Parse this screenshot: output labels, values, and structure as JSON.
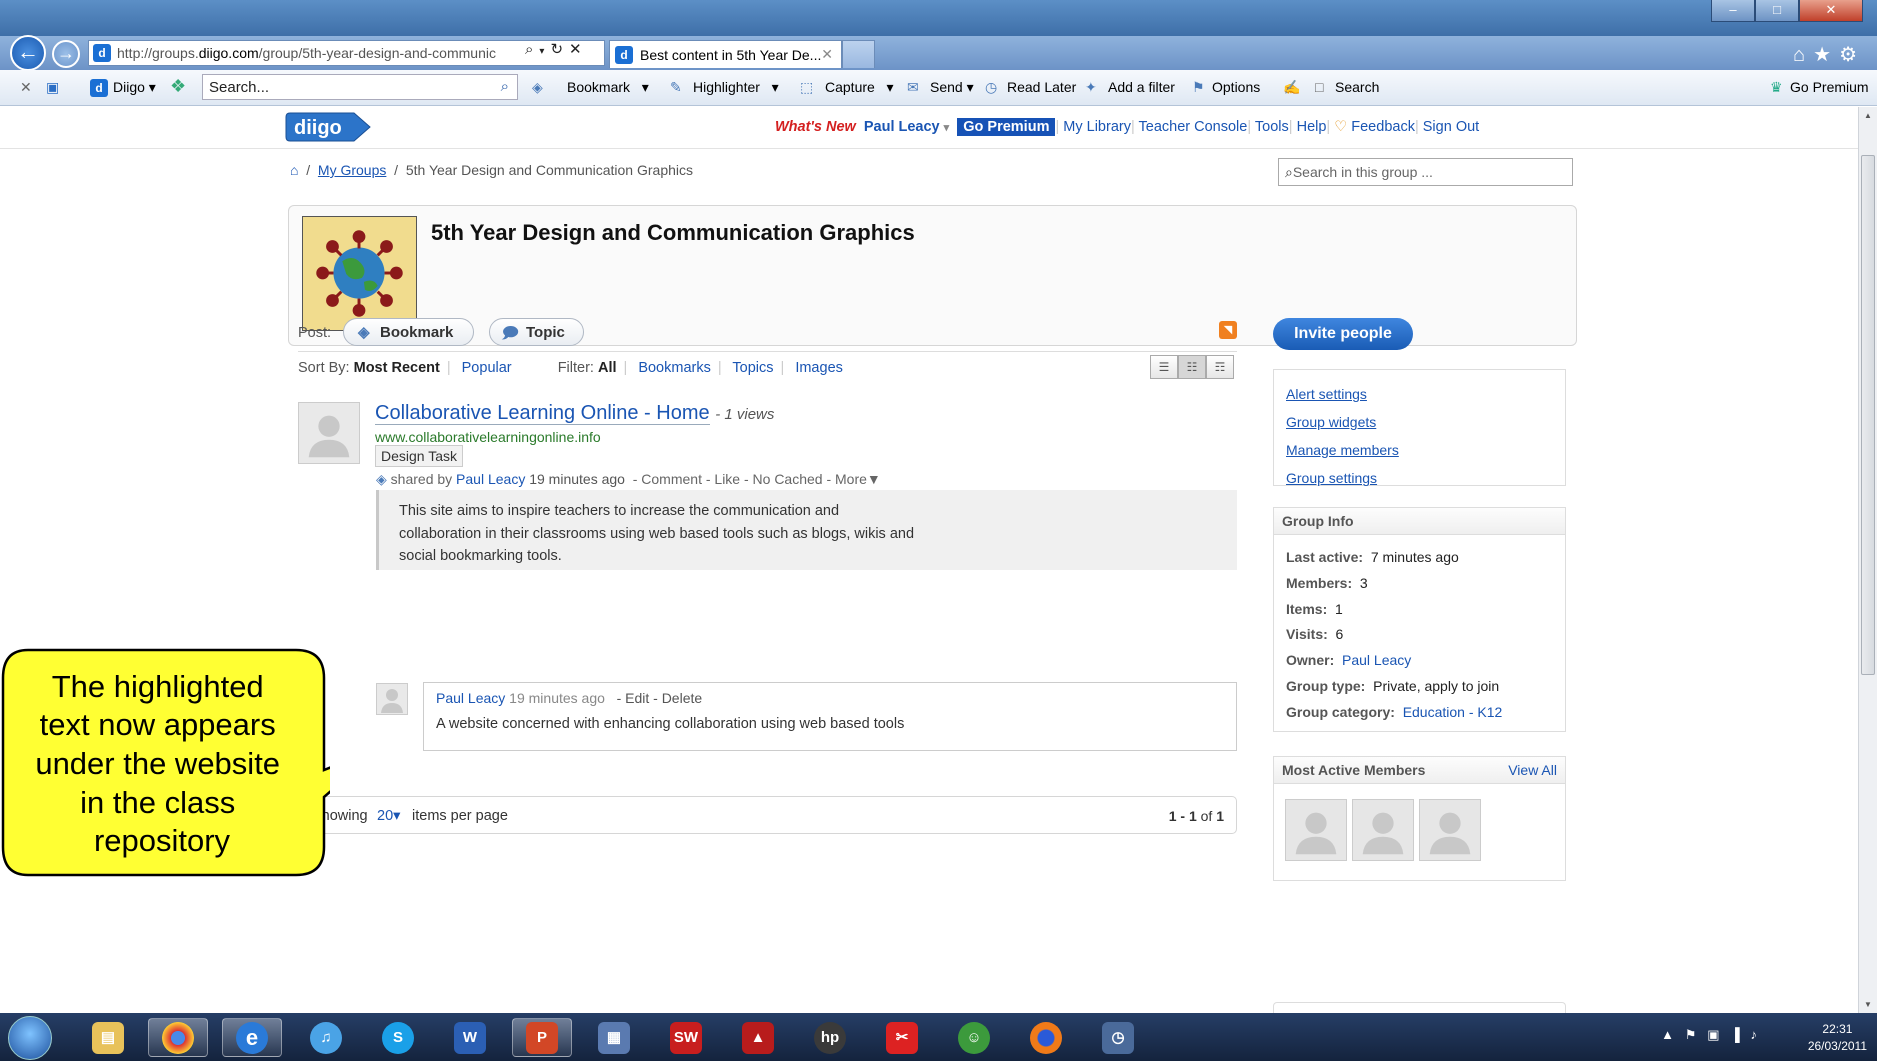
{
  "browser": {
    "address": "http://groups.diigo.com/group/5th-year-design-and-communic",
    "address_host_prefix": "http://groups.",
    "address_host": "diigo.com",
    "address_path": "/group/5th-year-design-and-communic",
    "tab_title": "Best content in 5th Year De...",
    "favicon_letter": "d"
  },
  "toolbar": {
    "diigo_label": "Diigo",
    "search_placeholder": "Search...",
    "items": [
      "Bookmark",
      "Highlighter",
      "Capture",
      "Send",
      "Read Later",
      "Add a filter",
      "Options",
      "Search"
    ],
    "go_premium": "Go Premium"
  },
  "header": {
    "logo": "diigo",
    "whats_new": "What's New",
    "user": "Paul Leacy",
    "go_premium": "Go Premium",
    "links": [
      "My Library",
      "Teacher Console",
      "Tools",
      "Help",
      "Feedback",
      "Sign Out"
    ]
  },
  "breadcrumb": {
    "my_groups": "My Groups",
    "current": "5th Year Design and Communication Graphics"
  },
  "group_search_placeholder": "Search in this group ...",
  "group": {
    "title": "5th Year Design and Communication Graphics"
  },
  "post": {
    "label": "Post:",
    "bookmark": "Bookmark",
    "topic": "Topic"
  },
  "sort": {
    "label": "Sort By:",
    "most_recent": "Most Recent",
    "popular": "Popular",
    "filter_label": "Filter:",
    "all": "All",
    "bookmarks": "Bookmarks",
    "topics": "Topics",
    "images": "Images"
  },
  "item": {
    "title": "Collaborative Learning Online - Home",
    "views": "- 1 views",
    "url": "www.collaborativelearningonline.info",
    "tag": "Design Task",
    "shared_by": "shared by",
    "user": "Paul Leacy",
    "time": "19 minutes ago",
    "actions": "- Comment - Like - No Cached - More▼",
    "highlight": [
      "This site aims to inspire teachers to increase the communication and",
      "collaboration in their classrooms using web based tools such as blogs, wikis and",
      "social bookmarking tools."
    ],
    "comment_user": "Paul Leacy",
    "comment_time": "19 minutes ago",
    "comment_actions": "- Edit - Delete",
    "comment_text": "A website concerned with enhancing collaboration using web based tools"
  },
  "pager": {
    "showing": "Showing",
    "per_page_value": "20▾",
    "per_page": "items per page",
    "range_a": "1",
    "range_b": "- 1",
    "range_c": "of",
    "range_d": "1"
  },
  "sidebar": {
    "invite": "Invite people",
    "admin_links": [
      "Alert settings",
      "Group widgets",
      "Manage members",
      "Group settings"
    ],
    "info_title": "Group Info",
    "info": [
      {
        "label": "Last active:",
        "value": "7 minutes ago"
      },
      {
        "label": "Members:",
        "value": "3"
      },
      {
        "label": "Items:",
        "value": "1"
      },
      {
        "label": "Visits:",
        "value": "6"
      },
      {
        "label": "Owner:",
        "value": "Paul Leacy"
      },
      {
        "label": "Group type:",
        "value": "Private, apply to join"
      },
      {
        "label": "Group category:",
        "value": "Education - K12"
      }
    ],
    "members_title": "Most Active Members",
    "view_all": "View All"
  },
  "callout": {
    "lines": [
      "The highlighted",
      "text now appears",
      "under the website",
      "in the class",
      "repository"
    ]
  },
  "taskbar": {
    "time": "22:31",
    "date": "26/03/2011"
  },
  "colors": {
    "link": "#1a55b3",
    "whats_new": "#d42020",
    "callout_fill": "#ffff33",
    "invite": "#1a5cb5"
  }
}
